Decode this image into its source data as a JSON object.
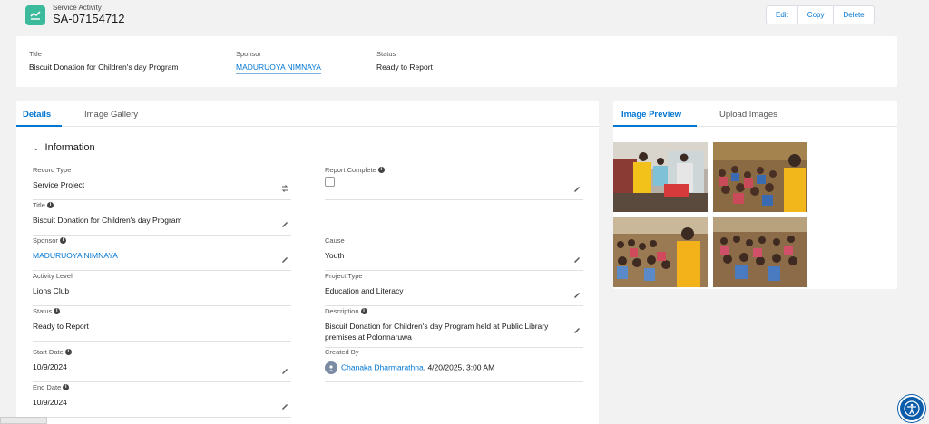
{
  "header": {
    "object_label": "Service Activity",
    "record_name": "SA-07154712",
    "buttons": {
      "edit": "Edit",
      "copy": "Copy",
      "delete": "Delete"
    }
  },
  "highlights": {
    "title_label": "Title",
    "title_value": "Biscuit Donation for Children's day Program",
    "sponsor_label": "Sponsor",
    "sponsor_value": "MADURUOYA NIMNAYA",
    "status_label": "Status",
    "status_value": "Ready to Report"
  },
  "main_tabs": {
    "details": "Details",
    "gallery": "Image Gallery"
  },
  "section": {
    "title": "Information"
  },
  "fields": {
    "record_type": {
      "label": "Record Type",
      "value": "Service Project"
    },
    "report_complete": {
      "label": "Report Complete"
    },
    "title": {
      "label": "Title",
      "value": "Biscuit Donation for Children's day Program"
    },
    "sponsor": {
      "label": "Sponsor",
      "value": "MADURUOYA NIMNAYA"
    },
    "cause": {
      "label": "Cause",
      "value": "Youth"
    },
    "activity_level": {
      "label": "Activity Level",
      "value": "Lions Club"
    },
    "project_type": {
      "label": "Project Type",
      "value": "Education and Literacy"
    },
    "status": {
      "label": "Status",
      "value": "Ready to Report"
    },
    "description": {
      "label": "Description",
      "value": "Biscuit Donation for Children's day Program held at Public Library premises at Polonnaruwa"
    },
    "start_date": {
      "label": "Start Date",
      "value": "10/9/2024"
    },
    "created_by": {
      "label": "Created By",
      "name": "Chanaka Dharmarathna",
      "date": ", 4/20/2025, 3:00 AM"
    },
    "end_date": {
      "label": "End Date",
      "value": "10/9/2024"
    }
  },
  "preview_tabs": {
    "preview": "Image Preview",
    "upload": "Upload Images"
  },
  "colors": {
    "brand": "#0176d3",
    "icon_teal": "#3bba9c",
    "accessibility": "#0b5cab"
  }
}
